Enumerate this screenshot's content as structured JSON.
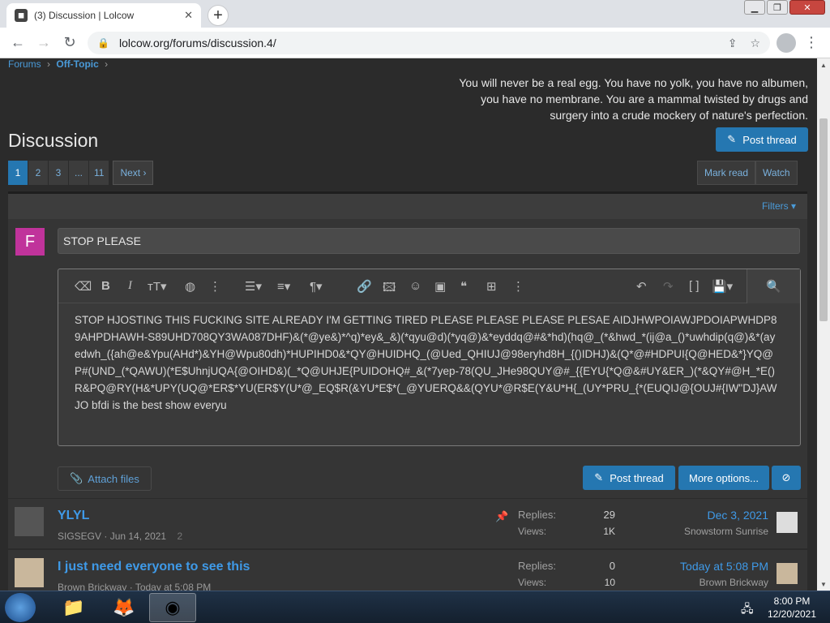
{
  "browser": {
    "tab_title": "(3) Discussion | Lolcow",
    "tab_close": "✕",
    "new_tab": "+",
    "url": "lolcow.org/forums/discussion.4/",
    "minimize": "▁",
    "maximize": "❐",
    "close": "✕"
  },
  "breadcrumb": {
    "forums": "Forums",
    "sep1": "›",
    "off_topic": "Off-Topic",
    "sep2": "›"
  },
  "quote": "You will never be a real egg. You have no yolk, you have no albumen, you have no membrane. You are a mammal twisted by drugs and surgery into a crude mockery of nature's perfection.",
  "page_title": "Discussion",
  "post_thread_label": "Post thread",
  "pager": [
    "1",
    "2",
    "3",
    "...",
    "11"
  ],
  "pager_next": "Next ›",
  "mark_read": "Mark read",
  "watch": "Watch",
  "filters": "Filters ▾",
  "composer": {
    "avatar_letter": "F",
    "title_value": "STOP PLEASE",
    "body_text": "STOP HJOSTING THIS FUCKING SITE ALREADY I'M GETTING TIRED PLEASE PLEASE PLEASE PLESAE AIDJHWPOIAWJPDOIAPWHDP89AHPDHAWH-S89UHD708QY3WA087DHF)&(*@ye&)*^q)*ey&_&)(*qyu@d)(*yq@)&*eyddq@#&*hd)(hq@_(*&hwd_*(ij@a_()*uwhdip(q@)&*(ayedwh_({ah@e&Ypu(AHd*)&YH@Wpu80dh)*HUPIHD0&*QY@HUIDHQ_(@Ued_QHIUJ@98eryhd8H_{()IDHJ)&(Q*@#HDPUI{Q@HED&*}YQ@P#(UND_(*QAWU)(*E$UhnjUQA{@OIHD&)(_*Q@UHJE{PUIDOHQ#_&(*7yep-78(QU_JHe98QUY@#_{{EYU{*Q@&#UY&ER_)(*&QY#@H_*E()R&PQ@RY(H&*UPY(UQ@*ER$*YU(ER$Y(U*@_EQ$R(&YU*E$*(_@YUERQ&&(QYU*@R$E(Y&U*H{_(UY*PRU_{*(EUQIJ@{OUJ#{IW\"DJ}AWJO bfdi is the best show everyu",
    "attach_files": "Attach files",
    "post_thread": "Post thread",
    "more_options": "More options...",
    "cancel_icon": "⃠"
  },
  "threads": [
    {
      "title": "YLYL",
      "author": "SIGSEGV",
      "date": "Jun 14, 2021",
      "pages": "2",
      "replies_label": "Replies:",
      "replies": "29",
      "views_label": "Views:",
      "views": "1K",
      "last_date": "Dec 3, 2021",
      "last_user": "Snowstorm Sunrise",
      "pinned": true
    },
    {
      "title": "I just need everyone to see this",
      "author": "Brown Brickway",
      "date": "Today at 5:08 PM",
      "pages": "",
      "replies_label": "Replies:",
      "replies": "0",
      "views_label": "Views:",
      "views": "10",
      "last_date": "Today at 5:08 PM",
      "last_user": "Brown Brickway",
      "pinned": false
    }
  ],
  "taskbar": {
    "time": "8:00 PM",
    "date": "12/20/2021"
  }
}
